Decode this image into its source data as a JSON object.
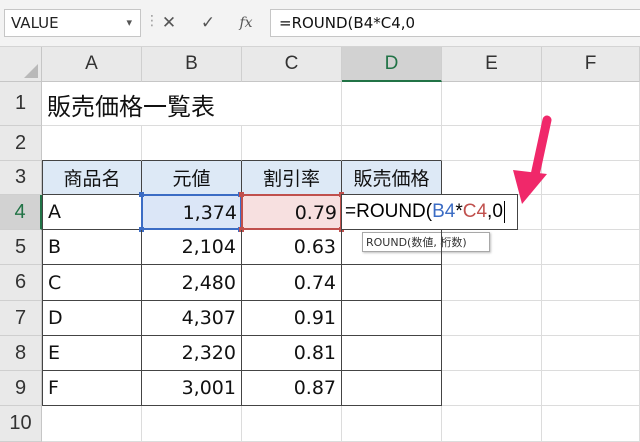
{
  "name_box": {
    "value": "VALUE",
    "dropdown_glyph": "▾"
  },
  "formula_bar": {
    "cancel_glyph": "✕",
    "enter_glyph": "✓",
    "fx_glyph": "fx",
    "separator_glyph": "⋮",
    "text": "=ROUND(B4*C4,0"
  },
  "columns": [
    "A",
    "B",
    "C",
    "D",
    "E",
    "F"
  ],
  "rows": [
    "1",
    "2",
    "3",
    "4",
    "5",
    "6",
    "7",
    "8",
    "9",
    "10"
  ],
  "sheet": {
    "title": "販売価格一覧表",
    "headers": [
      "商品名",
      "元値",
      "割引率",
      "販売価格"
    ],
    "data": [
      [
        "A",
        "1,374",
        "0.79"
      ],
      [
        "B",
        "2,104",
        "0.63"
      ],
      [
        "C",
        "2,480",
        "0.74"
      ],
      [
        "D",
        "4,307",
        "0.91"
      ],
      [
        "E",
        "2,320",
        "0.81"
      ],
      [
        "F",
        "3,001",
        "0.87"
      ]
    ]
  },
  "editing": {
    "prefix": "=ROUND(",
    "ref1": "B4",
    "op": "*",
    "ref2": "C4",
    "suffix": ",0"
  },
  "tooltip": "ROUND(数値, 桁数)",
  "colors": {
    "ref1": "#3b6cc4",
    "ref2": "#c0504d",
    "arrow": "#f0286a",
    "accent": "#217346",
    "header_fill": "#dde9f6"
  },
  "annotation_icon": "pointer-arrow-icon"
}
